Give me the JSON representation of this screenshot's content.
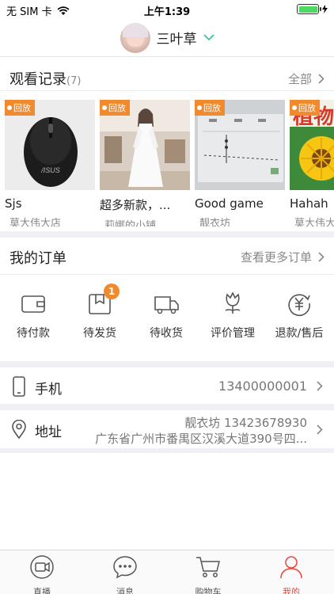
{
  "status_bar": {
    "carrier": "无 SIM 卡",
    "time": "上午1:39",
    "battery_level": 1.0
  },
  "header": {
    "username": "三叶草"
  },
  "history": {
    "title": "观看记录",
    "count": "(7)",
    "all_label": "全部",
    "items": [
      {
        "badge": "回放",
        "title": "Sjs",
        "shop": "莫大伟大店"
      },
      {
        "badge": "回放",
        "title": "超多新款，...",
        "shop": "莉娜的小铺"
      },
      {
        "badge": "回放",
        "title": "Good game",
        "shop": "靓衣坊"
      },
      {
        "badge": "回放",
        "title": "Hahah",
        "shop": "莫大伟大"
      }
    ]
  },
  "orders": {
    "title": "我的订单",
    "more_label": "查看更多订单",
    "items": [
      {
        "label": "待付款",
        "icon": "wallet-icon"
      },
      {
        "label": "待发货",
        "icon": "package-icon",
        "badge": "1"
      },
      {
        "label": "待收货",
        "icon": "truck-icon"
      },
      {
        "label": "评价管理",
        "icon": "flower-icon"
      },
      {
        "label": "退款/售后",
        "icon": "yen-refund-icon"
      }
    ]
  },
  "phone": {
    "label": "手机",
    "value": "13400000001"
  },
  "address": {
    "label": "地址",
    "name_phone": "靓衣坊  13423678930",
    "line": "广东省广州市番禺区汉溪大道390号四..."
  },
  "tabbar": {
    "items": [
      {
        "label": "直播",
        "icon": "live-camera-icon"
      },
      {
        "label": "消息",
        "icon": "message-icon"
      },
      {
        "label": "购物车",
        "icon": "cart-icon"
      },
      {
        "label": "我的",
        "icon": "profile-icon",
        "active": true
      }
    ]
  },
  "colors": {
    "accent": "#f08a2c",
    "active_tab": "#e8453c",
    "chevron_teal": "#3fbfa0"
  }
}
